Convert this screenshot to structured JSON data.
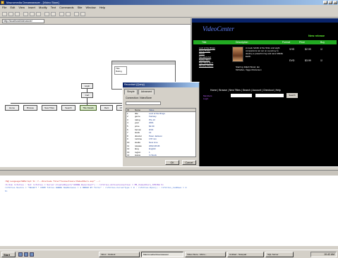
{
  "window": {
    "title": "Macromedia Dreamweaver - [Video Store]"
  },
  "menu": [
    "File",
    "Edit",
    "View",
    "Insert",
    "Modify",
    "Text",
    "Commands",
    "Site",
    "Window",
    "Help"
  ],
  "address": "http://localhost/videostore/",
  "flowchart": {
    "nodes": [
      "Home",
      "Browse",
      "New Titles",
      "Search",
      "Title Details",
      "Rent",
      "Checkout"
    ],
    "top_node": "Login",
    "mid_node": "Cart"
  },
  "smallwin": {
    "items": [
      "Title",
      "Rating"
    ]
  },
  "dialog": {
    "title": "Recordset (Query)",
    "tabs": [
      "Simple",
      "Advanced"
    ],
    "label": "Connection: VideoStore",
    "list_header": [
      "ID",
      "Name",
      "Value"
    ],
    "rows": [
      [
        "1",
        "title",
        "Lord of the Rings"
      ],
      [
        "2",
        "genre",
        "Fantasy"
      ],
      [
        "3",
        "rating",
        "PG-13"
      ],
      [
        "4",
        "year",
        "2001"
      ],
      [
        "5",
        "price",
        "$3.99"
      ],
      [
        "6",
        "format",
        "DVD"
      ],
      [
        "7",
        "stock",
        "12"
      ],
      [
        "8",
        "director",
        "Peter Jackson"
      ],
      [
        "9",
        "runtime",
        "178 min"
      ],
      [
        "10",
        "studio",
        "New Line"
      ],
      [
        "11",
        "release",
        "2002-08-06"
      ],
      [
        "12",
        "lang",
        "English"
      ],
      [
        "13",
        "region",
        "1"
      ],
      [
        "14",
        "status",
        "In Stock"
      ]
    ],
    "buttons": [
      "OK",
      "Cancel"
    ]
  },
  "preview": {
    "logo": "VideoCenter",
    "new_release": "New release",
    "columns": [
      "Title",
      "Description",
      "Format",
      "Price",
      "Buy"
    ],
    "links": [
      "Lord of the Rings",
      "Harry Potter",
      "Shrek",
      "Monsters Inc",
      "Spider-Man",
      "Star Wars Ep II",
      "Minority Report"
    ],
    "description": "A meek hobbit of the Shire and eight companions set out on a journey to destroy a powerful ring and save Middle Earth.",
    "caption": "Starring: Elijah Wood, Ian McKellen, Viggo Mortensen",
    "rows": [
      [
        "VHS",
        "$2.99"
      ],
      [
        "DVD",
        "$3.99"
      ]
    ],
    "bottom_nav": "Home | Browse | New Titles | Search | Account | Checkout | Help",
    "side": [
      "Members",
      "Login"
    ],
    "go": "Search"
  },
  "output_lines": [
    "<%@ Language=VBScript %> <!--#include file=\"Connections/VideoStore.asp\" -->",
    "<% Dim rsTitles : Set rsTitles = Server.CreateObject(\"ADODB.Recordset\") : rsTitles.ActiveConnection = MM_VideoStore_STRING %>",
    "rsTitles.Source = \"SELECT * FROM Titles WHERE NewRelease = 1 ORDER BY Title\" : rsTitles.CursorType = 0 : rsTitles.Open() : rsTitles_numRows = 0",
    "%>"
  ],
  "taskbar": {
    "start": "Start",
    "tasks": [
      "Inbox - Outlook",
      "Macromedia Dreamweaver",
      "Video Store - Micro...",
      "Untitled - Notepad",
      "SQL Server"
    ],
    "clock": "10:42 AM"
  }
}
